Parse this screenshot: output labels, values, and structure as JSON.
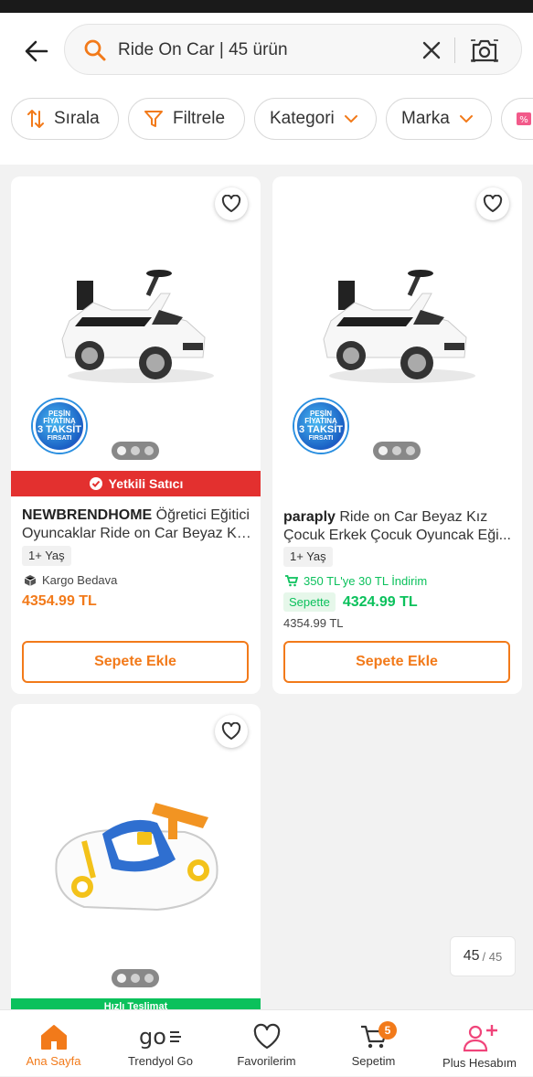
{
  "search": {
    "query": "Ride On Car | 45 ürün"
  },
  "filters": {
    "sort": "Sırala",
    "filter": "Filtrele",
    "category": "Kategori",
    "brand": "Marka"
  },
  "products": [
    {
      "brand": "NEWBRENDHOME",
      "name_line1": " Öğretici Eğitici",
      "name_line2": "Oyuncaklar Ride on Car Beyaz Kı...",
      "badge": {
        "line1": "PEŞİN FİYATINA",
        "line2": "3 TAKSİT",
        "line3": "FIRSATI"
      },
      "seller_label": "Yetkili Satıcı",
      "age": "1+ Yaş",
      "shipping": "Kargo Bedava",
      "price": "4354.99 TL",
      "add_label": "Sepete Ekle"
    },
    {
      "brand": "paraply",
      "name_line1": " Ride on Car Beyaz Kız",
      "name_line2": "Çocuk Erkek Çocuk Oyuncak Eği...",
      "badge": {
        "line1": "PEŞİN FİYATINA",
        "line2": "3 TAKSİT",
        "line3": "FIRSATI"
      },
      "age": "1+ Yaş",
      "promo": "350 TL'ye 30 TL İndirim",
      "cart_tag": "Sepette",
      "cart_price": "4324.99 TL",
      "old_price": "4354.99 TL",
      "add_label": "Sepete Ekle"
    },
    {
      "strip_label": "Hızlı Teslimat"
    }
  ],
  "pager": {
    "current": "45",
    "total": "/ 45"
  },
  "tabbar": {
    "home": "Ana Sayfa",
    "go": "Trendyol Go",
    "favorites": "Favorilerim",
    "cart": "Sepetim",
    "cart_count": "5",
    "account": "Plus Hesabım"
  },
  "colors": {
    "accent": "#f27a1a",
    "seller_red": "#e3302f",
    "promo_green": "#0bc15c"
  }
}
